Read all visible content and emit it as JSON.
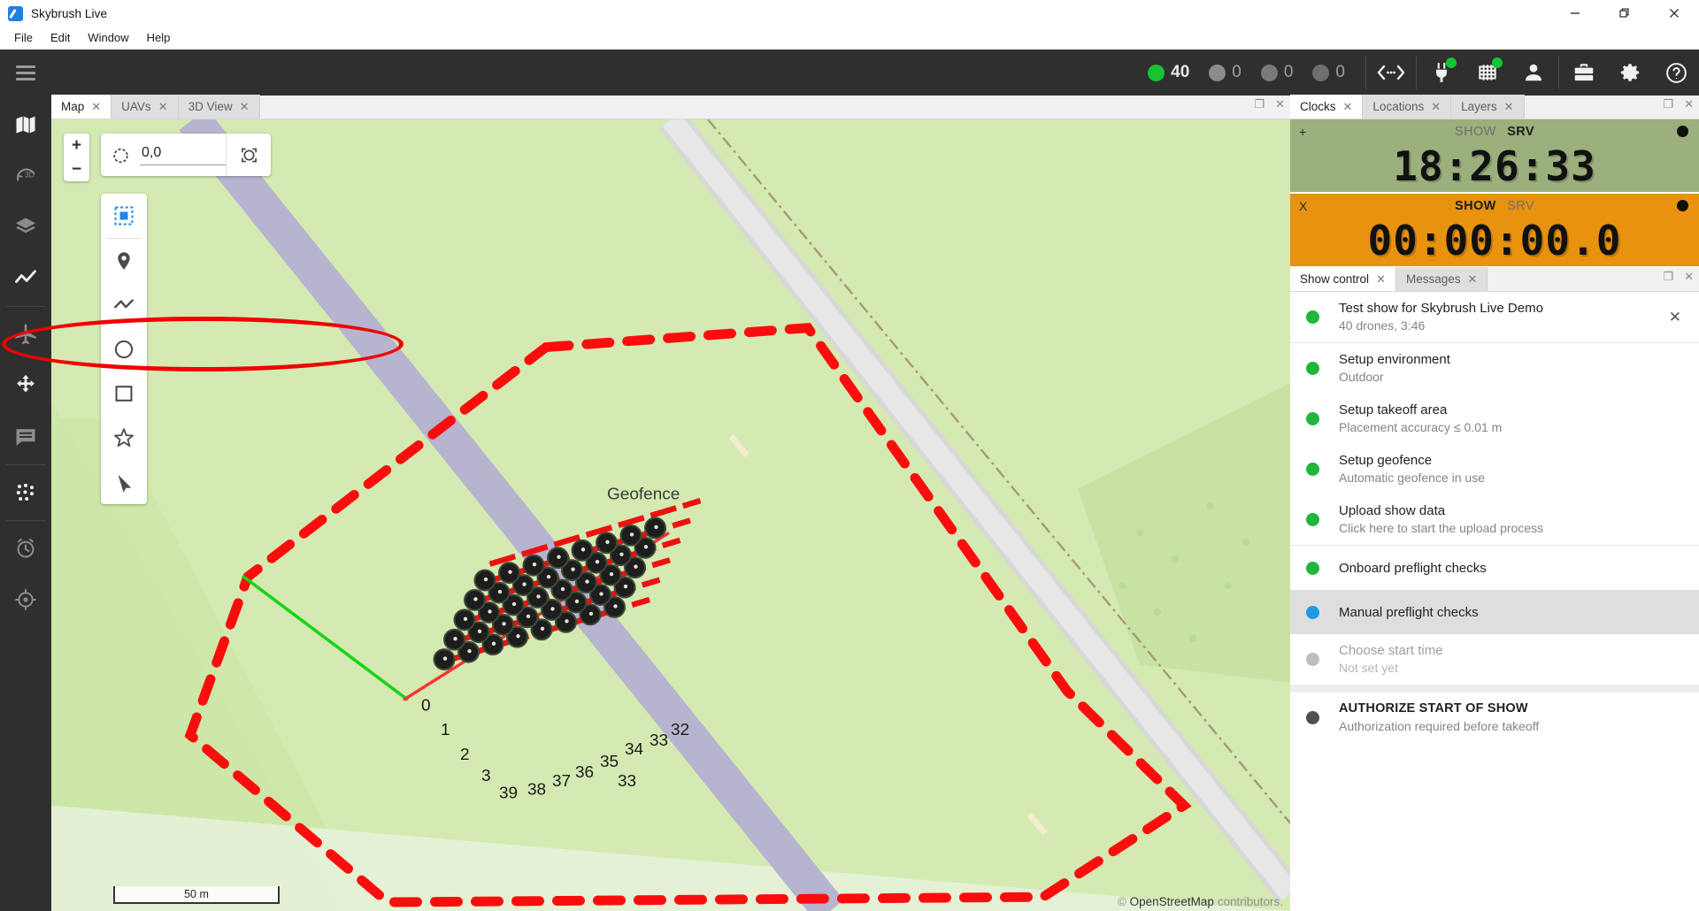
{
  "window": {
    "title": "Skybrush Live",
    "logo_icon": "skybrush-logo-icon",
    "minimize": "—",
    "maximize": "❐",
    "close": "✕"
  },
  "menubar": {
    "items": [
      "File",
      "Edit",
      "Window",
      "Help"
    ]
  },
  "toolbar": {
    "hamburger_icon": "hamburger-menu-icon",
    "status": [
      {
        "label": "40",
        "color": "#14c433",
        "state": "ok"
      },
      {
        "label": "0",
        "color": "#8c8c8c",
        "state": "warning"
      },
      {
        "label": "0",
        "color": "#7a7a7a",
        "state": "error"
      },
      {
        "label": "0",
        "color": "#6f6f6f",
        "state": "offline"
      }
    ],
    "buttons": [
      {
        "icon": "connection-arrows-icon",
        "badge": null
      },
      {
        "icon": "power-plug-icon",
        "badge": "#14c433"
      },
      {
        "icon": "beacon-grid-icon",
        "badge": "#14c433"
      },
      {
        "icon": "person-icon",
        "badge": null
      },
      {
        "icon": "briefcase-icon",
        "badge": null
      },
      {
        "icon": "gear-icon",
        "badge": null
      },
      {
        "icon": "help-circle-icon",
        "badge": null
      }
    ]
  },
  "rail": {
    "items": [
      {
        "icon": "map-icon",
        "active": true
      },
      {
        "icon": "3d-view-icon",
        "active": false
      },
      {
        "icon": "layers-icon",
        "active": false
      },
      {
        "icon": "chart-line-icon",
        "active": true
      },
      {
        "icon": "airplane-icon",
        "active": false
      },
      {
        "icon": "dpad-move-icon",
        "active": true
      },
      {
        "icon": "messages-icon",
        "active": false
      },
      {
        "icon": "swarm-dots-icon",
        "active": true
      },
      {
        "icon": "alarm-clock-icon",
        "active": false
      },
      {
        "icon": "locate-target-icon",
        "active": false
      }
    ]
  },
  "map_panel": {
    "tabs": [
      {
        "label": "Map",
        "active": true
      },
      {
        "label": "UAVs",
        "active": false
      },
      {
        "label": "3D View",
        "active": false
      }
    ],
    "controls": {
      "maximize_icon": "maximize-icon",
      "close_icon": "close-icon"
    },
    "zoom_in": "+",
    "zoom_out": "−",
    "rotation_reset_icon": "rotation-reset-icon",
    "rotation_value": "0,0",
    "rotation_placeholder": "0,0",
    "fit_icon": "fit-to-screen-icon",
    "draw_tools": [
      {
        "icon": "select-box-icon",
        "active": true
      },
      {
        "icon": "map-pin-icon",
        "active": false
      },
      {
        "icon": "polyline-icon",
        "active": false
      },
      {
        "icon": "circle-icon",
        "active": false
      },
      {
        "icon": "rectangle-icon",
        "active": false
      },
      {
        "icon": "star-polygon-icon",
        "active": false
      },
      {
        "icon": "cursor-arrow-icon",
        "active": false
      }
    ],
    "geofence_label": "Geofence",
    "scale_bar": "50 m",
    "attribution_symbol": "©",
    "attribution_name": "OpenStreetMap",
    "attribution_suffix": "contributors.",
    "drone_labels": [
      "0",
      "1",
      "2",
      "3",
      "39",
      "38",
      "37",
      "36",
      "35",
      "34",
      "33",
      "32",
      "33"
    ]
  },
  "clocks_panel": {
    "tabs": [
      {
        "label": "Clocks",
        "active": true
      },
      {
        "label": "Locations",
        "active": false
      },
      {
        "label": "Layers",
        "active": false
      }
    ],
    "controls": {
      "maximize_icon": "maximize-icon",
      "close_icon": "close-icon"
    },
    "clocks": [
      {
        "badge": "+",
        "label_show": "SHOW",
        "label_srv": "SRV",
        "active_label": "SRV",
        "time": "18:26:33",
        "color": "#9bb07c"
      },
      {
        "badge": "X",
        "label_show": "SHOW",
        "label_srv": "SRV",
        "active_label": "SHOW",
        "time": "00:00:00.0",
        "color": "#e8920f"
      }
    ]
  },
  "show_panel": {
    "tabs": [
      {
        "label": "Show control",
        "active": true
      },
      {
        "label": "Messages",
        "active": false
      }
    ],
    "controls": {
      "maximize_icon": "maximize-icon",
      "close_icon": "close-icon"
    },
    "header": {
      "title": "Test show for Skybrush Live Demo",
      "subtitle": "40 drones, 3:46",
      "dot_color": "#20b63c",
      "close_icon": "clear-show-icon"
    },
    "steps": [
      {
        "title": "Setup environment",
        "subtitle": "Outdoor",
        "dot_color": "#20b63c",
        "selected": false,
        "muted": false,
        "bold": false
      },
      {
        "title": "Setup takeoff area",
        "subtitle": "Placement accuracy ≤ 0.01 m",
        "dot_color": "#20b63c",
        "selected": false,
        "muted": false,
        "bold": false
      },
      {
        "title": "Setup geofence",
        "subtitle": "Automatic geofence in use",
        "dot_color": "#20b63c",
        "selected": false,
        "muted": false,
        "bold": false
      },
      {
        "title": "Upload show data",
        "subtitle": "Click here to start the upload process",
        "dot_color": "#20b63c",
        "selected": false,
        "muted": false,
        "bold": false
      },
      {
        "title": "Onboard preflight checks",
        "subtitle": "",
        "dot_color": "#20b63c",
        "selected": false,
        "muted": false,
        "bold": false
      },
      {
        "title": "Manual preflight checks",
        "subtitle": "",
        "dot_color": "#1e9ae0",
        "selected": true,
        "muted": false,
        "bold": false
      },
      {
        "title": "Choose start time",
        "subtitle": "Not set yet",
        "dot_color": "#bdbdbd",
        "selected": false,
        "muted": true,
        "bold": false
      },
      {
        "title": "AUTHORIZE START OF SHOW",
        "subtitle": "Authorization required before takeoff",
        "dot_color": "#4f4f4f",
        "selected": false,
        "muted": false,
        "bold": true
      }
    ],
    "annotation": {
      "shape": "ellipse",
      "color": "#f00000",
      "target": "Manual preflight checks"
    }
  }
}
